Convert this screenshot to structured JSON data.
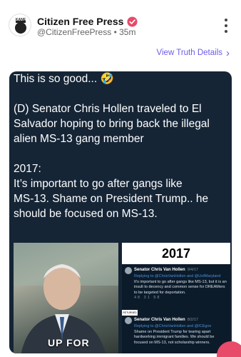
{
  "header": {
    "account_name": "Citizen Free Press",
    "handle": "@CitizenFreePress",
    "separator": "•",
    "time_ago": "35m",
    "avatar_text": "KANE",
    "verified_icon": "verified-badge-icon",
    "more_icon": "more-vertical-icon"
  },
  "view_truth_details": {
    "label": "View Truth Details",
    "chevron": "›"
  },
  "post": {
    "lines": [
      "This is so good... 🤣",
      "",
      "(D) Senator Chris Hollen traveled to El",
      "Salvador hoping to bring back the illegal",
      "alien MS-13 gang member",
      "",
      "2017:",
      "It’s important to go after gangs like",
      "MS-13. Shame on President Trump.. he",
      "should be focused on MS-13."
    ]
  },
  "image": {
    "photo_caption": "UP FOR",
    "year": "2017",
    "tweet1": {
      "name": "Senator Chris Van Hollen",
      "date": "9/4/17",
      "reply": "Replying to @ChrisVanHollen and @UofMaryland",
      "body": "It's important to go after gangs like MS-13, but it is an insult to decency and common sense for DREAMers to be targeted for deportation.",
      "actions": "48   31   98"
    },
    "tweet2": {
      "name": "Senator Chris Van Hollen",
      "date": "8/2/17",
      "reply": "Replying to @ChrisVanHollen and @ICEgov",
      "body": "Shame on President Trump for tearing apart hardworking immigrant families. We should be focused on MS-13, not scholarship winners."
    },
    "mini_label": "RETURNED"
  },
  "colors": {
    "accent": "#6b5ce7",
    "verified": "#e84a6a",
    "media_bg": "#152536"
  }
}
